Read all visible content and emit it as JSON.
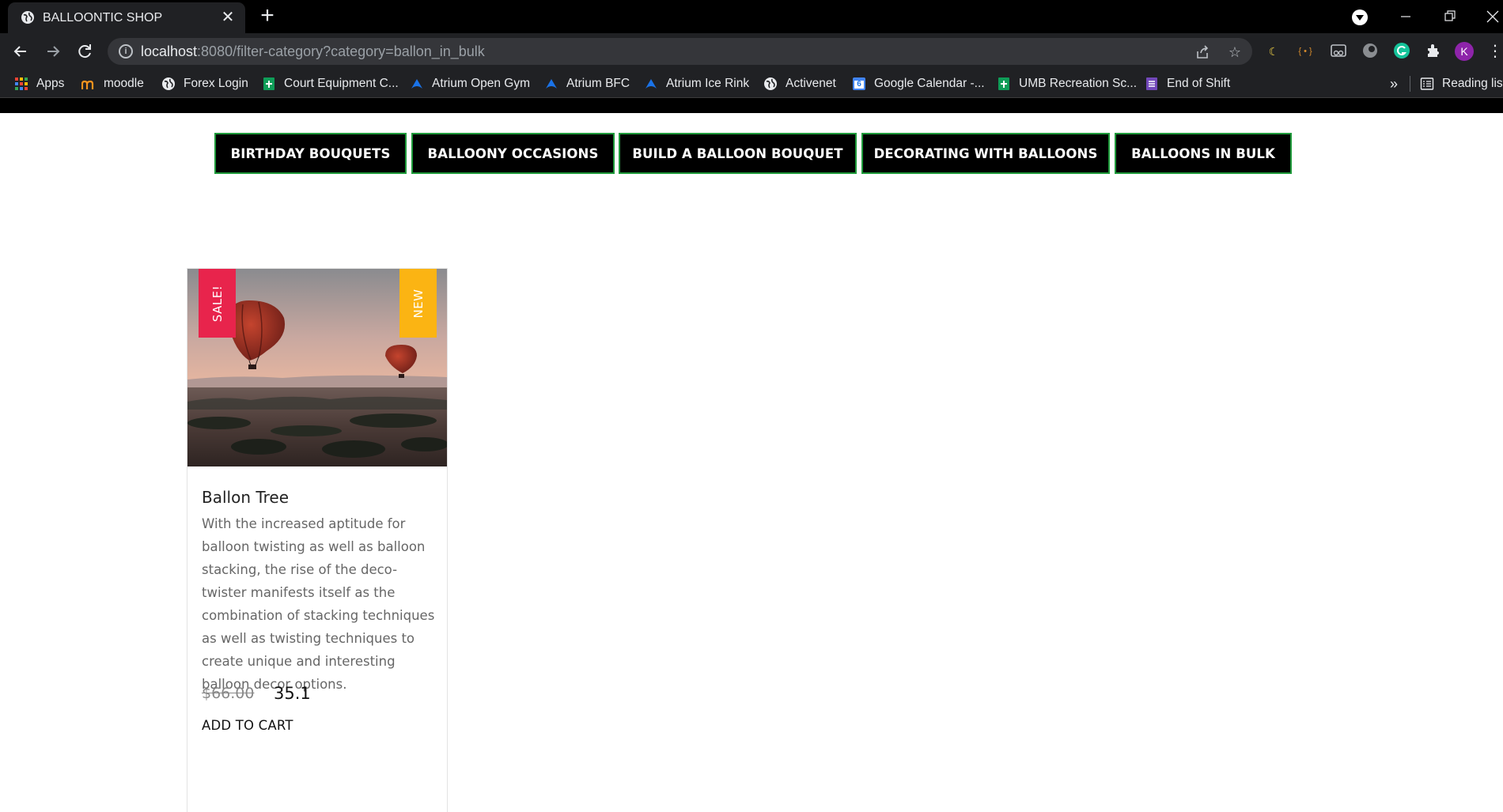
{
  "browser": {
    "tab_title": "BALLOONTIC SHOP",
    "url_host": "localhost",
    "url_rest": ":8080/filter-category?category=ballon_in_bulk",
    "bookmarks": [
      {
        "label": "Apps",
        "icon": "apps-grid-icon"
      },
      {
        "label": "moodle",
        "icon": "moodle-icon"
      },
      {
        "label": "Forex Login",
        "icon": "globe-icon"
      },
      {
        "label": "Court Equipment C...",
        "icon": "sheets-icon"
      },
      {
        "label": "Atrium Open Gym",
        "icon": "activenet-icon"
      },
      {
        "label": "Atrium BFC",
        "icon": "activenet-icon"
      },
      {
        "label": "Atrium Ice Rink",
        "icon": "activenet-icon"
      },
      {
        "label": "Activenet",
        "icon": "globe-icon"
      },
      {
        "label": "Google Calendar -...",
        "icon": "calendar-icon"
      },
      {
        "label": "UMB Recreation Sc...",
        "icon": "sheets-icon"
      },
      {
        "label": "End of Shift",
        "icon": "forms-icon"
      }
    ],
    "overflow_label": "»",
    "reading_list_label": "Reading list",
    "profile_initial": "K",
    "calendar_day": "6"
  },
  "categories": [
    "BIRTHDAY BOUQUETS",
    "BALLOONY OCCASIONS",
    "BUILD A BALLOON BOUQUET",
    "DECORATING WITH BALLOONS",
    "BALLOONS IN BULK"
  ],
  "product": {
    "name": "Ballon Tree",
    "description": "With the increased aptitude for balloon twisting as well as balloon stacking, the rise of the deco-twister manifests itself as the combination of stacking techniques as well as twisting techniques to create unique and interesting balloon decor options.",
    "old_price": "$66.00",
    "price": "35.1",
    "sale_badge": "SALE!",
    "new_badge": "NEW",
    "add_to_cart": "ADD TO CART"
  },
  "colors": {
    "nav_border": "#1f9a3b",
    "sale_badge": "#e8244c",
    "new_badge": "#fbb413"
  }
}
